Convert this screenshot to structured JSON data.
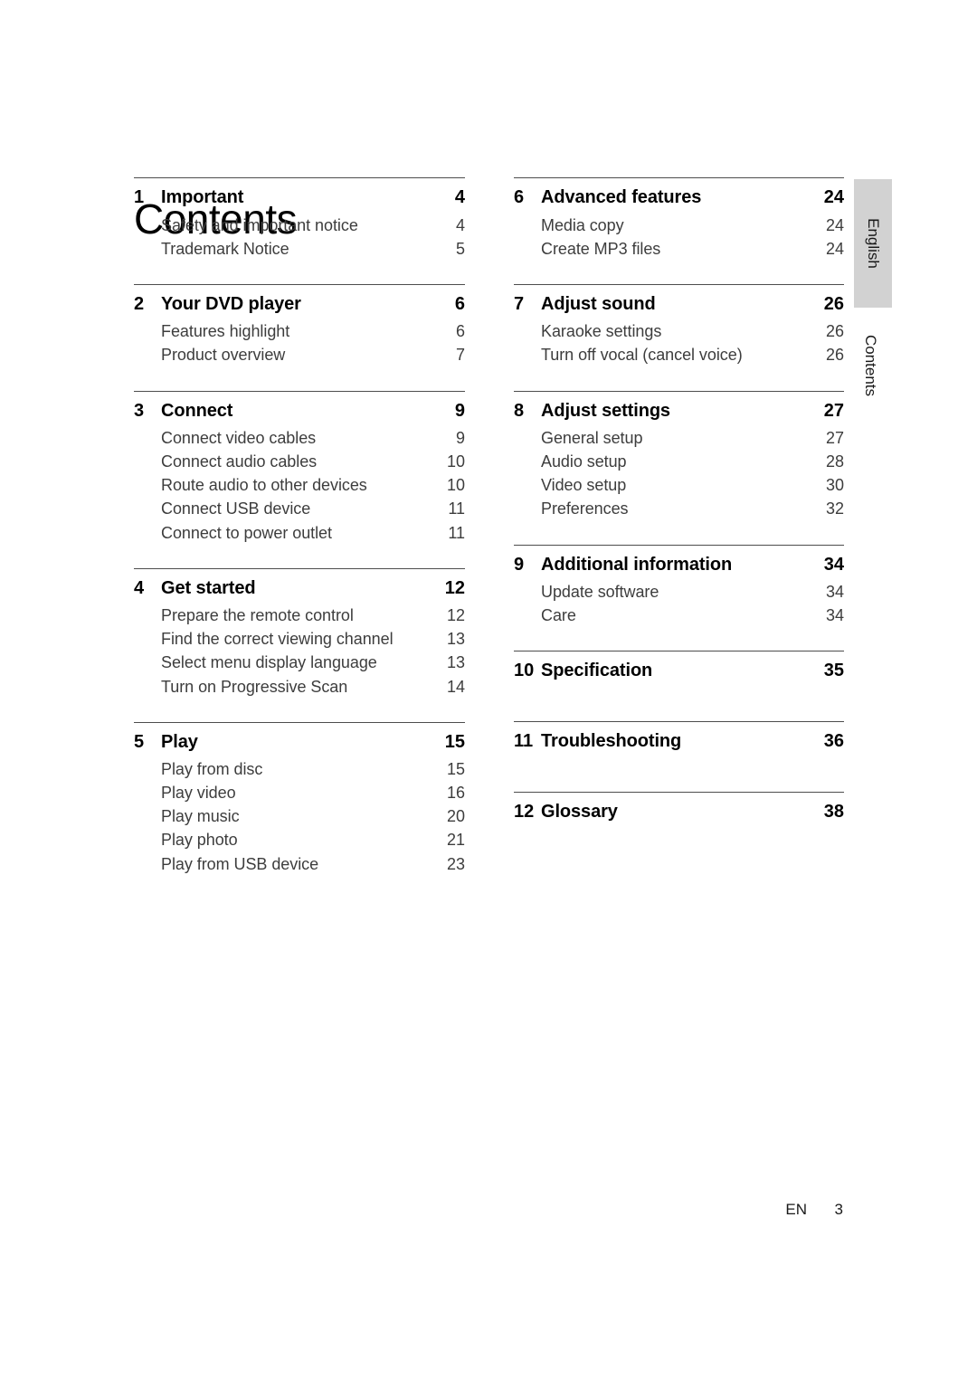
{
  "page": {
    "title": "Contents",
    "side_tab_text": "English",
    "side_label_text": "Contents",
    "footer": {
      "language_code": "EN",
      "page_number": "3"
    },
    "rule_color": "#4d4d4d",
    "side_tab_color": "#d2d2d2"
  },
  "columns": [
    {
      "name": "left",
      "blocks": [
        {
          "num": "1",
          "label": "Important",
          "page": "4",
          "subs": [
            {
              "label": "Safety and important notice",
              "page": "4"
            },
            {
              "label": "Trademark Notice",
              "page": "5"
            }
          ]
        },
        {
          "num": "2",
          "label": "Your DVD player",
          "page": "6",
          "subs": [
            {
              "label": "Features highlight",
              "page": "6"
            },
            {
              "label": "Product overview",
              "page": "7"
            }
          ]
        },
        {
          "num": "3",
          "label": "Connect",
          "page": "9",
          "subs": [
            {
              "label": "Connect video cables",
              "page": "9"
            },
            {
              "label": "Connect audio cables",
              "page": "10"
            },
            {
              "label": "Route audio to other devices",
              "page": "10"
            },
            {
              "label": "Connect USB device",
              "page": "11"
            },
            {
              "label": "Connect to power outlet",
              "page": "11"
            }
          ]
        },
        {
          "num": "4",
          "label": "Get started",
          "page": "12",
          "subs": [
            {
              "label": "Prepare the remote control",
              "page": "12"
            },
            {
              "label": "Find the correct viewing channel",
              "page": "13"
            },
            {
              "label": "Select menu display language",
              "page": "13"
            },
            {
              "label": "Turn on Progressive Scan",
              "page": "14"
            }
          ]
        },
        {
          "num": "5",
          "label": "Play",
          "page": "15",
          "subs": [
            {
              "label": "Play from disc",
              "page": "15"
            },
            {
              "label": "Play video",
              "page": "16"
            },
            {
              "label": "Play music",
              "page": "20"
            },
            {
              "label": "Play photo",
              "page": "21"
            },
            {
              "label": "Play from USB device",
              "page": "23"
            }
          ]
        }
      ]
    },
    {
      "name": "right",
      "blocks": [
        {
          "num": "6",
          "label": "Advanced features",
          "page": "24",
          "subs": [
            {
              "label": "Media copy",
              "page": "24"
            },
            {
              "label": "Create MP3 files",
              "page": "24"
            }
          ]
        },
        {
          "num": "7",
          "label": "Adjust sound",
          "page": "26",
          "subs": [
            {
              "label": "Karaoke settings",
              "page": "26"
            },
            {
              "label": "Turn off vocal (cancel voice)",
              "page": "26"
            }
          ]
        },
        {
          "num": "8",
          "label": "Adjust settings",
          "page": "27",
          "subs": [
            {
              "label": "General setup",
              "page": "27"
            },
            {
              "label": "Audio setup",
              "page": "28"
            },
            {
              "label": "Video setup",
              "page": "30"
            },
            {
              "label": "Preferences",
              "page": "32"
            }
          ]
        },
        {
          "num": "9",
          "label": "Additional information",
          "page": "34",
          "subs": [
            {
              "label": "Update software",
              "page": "34"
            },
            {
              "label": "Care",
              "page": "34"
            }
          ]
        },
        {
          "num": "10",
          "label": "Specification",
          "page": "35",
          "subs": []
        },
        {
          "num": "11",
          "label": "Troubleshooting",
          "page": "36",
          "subs": []
        },
        {
          "num": "12",
          "label": "Glossary",
          "page": "38",
          "subs": []
        }
      ]
    }
  ]
}
